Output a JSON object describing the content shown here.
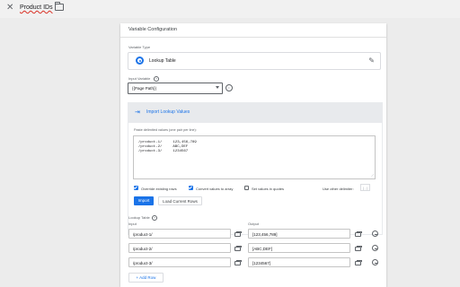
{
  "window": {
    "title": "Product IDs"
  },
  "card": {
    "title": "Variable Configuration"
  },
  "variable_type": {
    "label": "Variable Type",
    "value": "Lookup Table"
  },
  "input_variable": {
    "label": "Input Variable",
    "selected": "{{Page Path}}"
  },
  "import": {
    "link": "Import Lookup Values",
    "textarea_label": "Paste delimited values (one pair per line):",
    "lines": [
      "/product-1/     123,456,789",
      "/product-2/     ABC,DEF",
      "/product-3/     1234567"
    ],
    "checkboxes": [
      {
        "label": "Override existing rows",
        "checked": true
      },
      {
        "label": "Convert values to array",
        "checked": true
      },
      {
        "label": "Set values in quotes",
        "checked": false
      }
    ],
    "delimiter_label": "Use other delimiter:",
    "delimiter_value": "( , )",
    "import_button": "Import",
    "load_button": "Load Current Rows"
  },
  "lookup_table": {
    "label": "Lookup Table",
    "input_header": "Input",
    "output_header": "Output",
    "rows": [
      {
        "input": "/product-1/",
        "output": "[123,456,789]"
      },
      {
        "input": "/product-2/",
        "output": "[ABC,DEF]"
      },
      {
        "input": "/product-3/",
        "output": "[1234567]"
      }
    ],
    "add_row": "+ Add Row"
  },
  "colors": {
    "accent": "#1a73e8",
    "background": "#ececec"
  }
}
